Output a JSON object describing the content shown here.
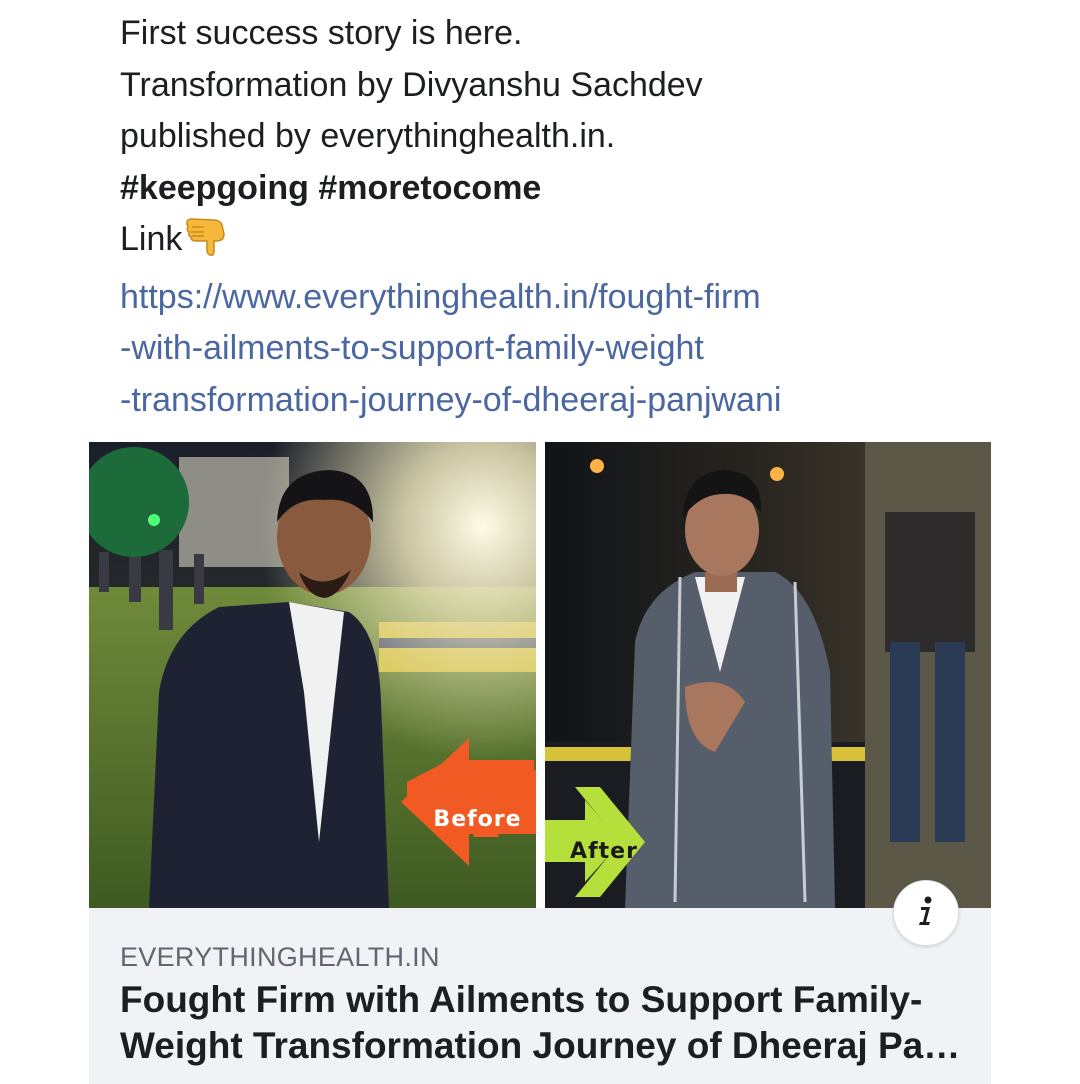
{
  "post": {
    "line1": "First success story is here.",
    "line2": "Transformation by Divyanshu Sachdev",
    "line3": "published by everythinghealth.in.",
    "hashtags": "#keepgoing #moretocome",
    "link_label": "Link",
    "link_icon": "backhand-index-pointing-down-emoji",
    "url_line1": "https://www.everythinghealth.in/fought-firm",
    "url_line2": "-with-ailments-to-support-family-weight",
    "url_line3": "-transformation-journey-of-dheeraj-panjwani",
    "link_color": "#4b67a1"
  },
  "preview": {
    "before_label": "Before",
    "after_label": "After",
    "before_arrow_color": "#f15a22",
    "after_arrow_color": "#b5e03c",
    "info_icon": "info-icon",
    "domain": "EVERYTHINGHEALTH.IN",
    "title_line1": "Fought Firm with Ailments to Support Family-",
    "title_line2": "Weight Transformation Journey of Dheeraj Pa…"
  }
}
